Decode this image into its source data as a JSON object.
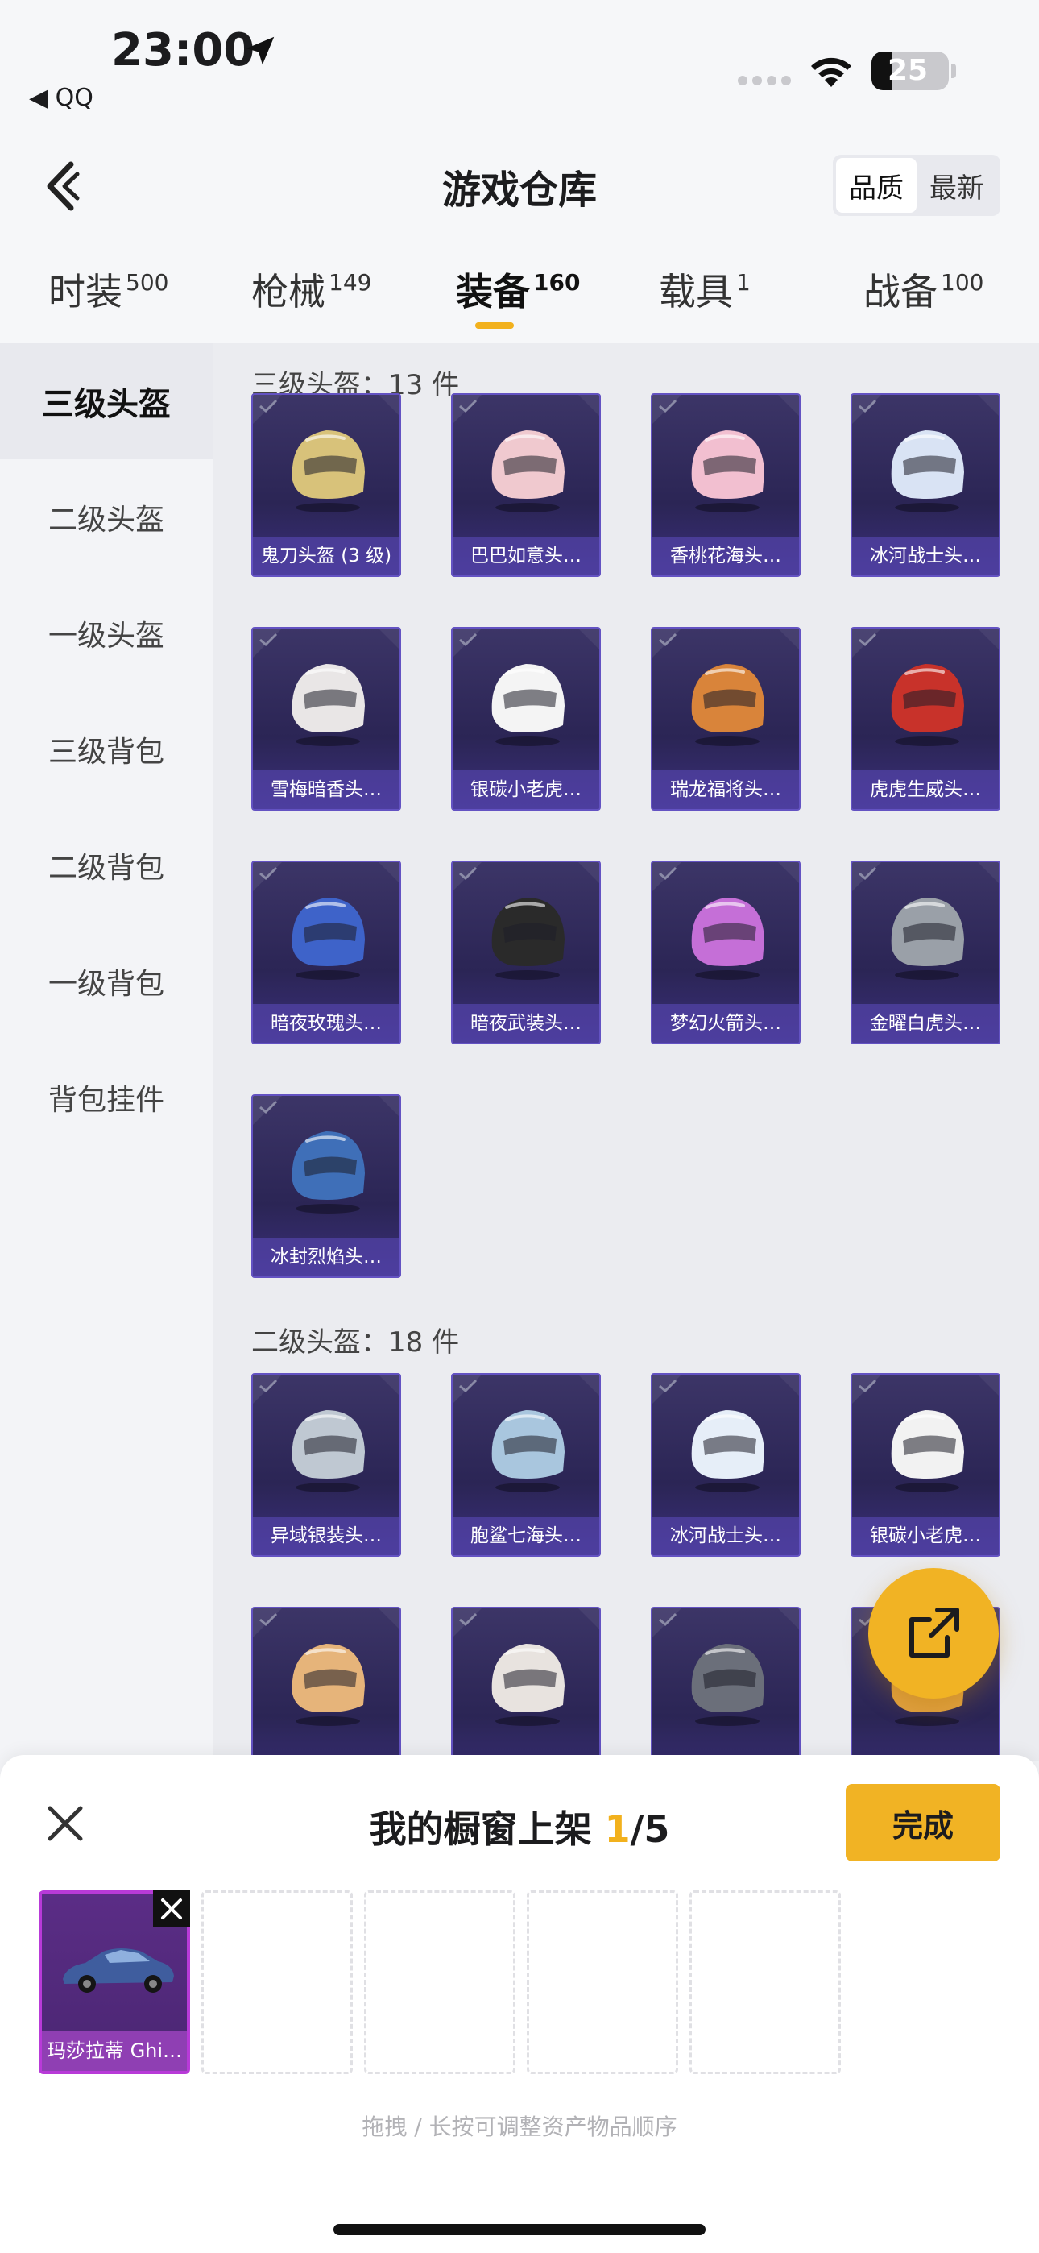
{
  "status_bar": {
    "time": "23:00",
    "back_app": "◀ QQ",
    "battery": "25"
  },
  "header": {
    "title": "游戏仓库",
    "sort_options": [
      "品质",
      "最新"
    ],
    "sort_active": "品质"
  },
  "tabs": [
    {
      "label": "时装",
      "count": "500"
    },
    {
      "label": "枪械",
      "count": "149"
    },
    {
      "label": "装备",
      "count": "160",
      "active": true
    },
    {
      "label": "载具",
      "count": "1"
    },
    {
      "label": "战备",
      "count": "100"
    }
  ],
  "sidebar": {
    "items": [
      "三级头盔",
      "二级头盔",
      "一级头盔",
      "三级背包",
      "二级背包",
      "一级背包",
      "背包挂件"
    ],
    "active": "三级头盔"
  },
  "sections": [
    {
      "title": "三级头盔：13 件",
      "items": [
        "鬼刀头盔 (3 级)",
        "巴巴如意头…",
        "香桃花海头…",
        "冰河战士头…",
        "雪梅暗香头…",
        "银碳小老虎…",
        "瑞龙福将头…",
        "虎虎生威头…",
        "暗夜玫瑰头…",
        "暗夜武装头…",
        "梦幻火箭头…",
        "金曜白虎头…",
        "冰封烈焰头…"
      ]
    },
    {
      "title": "二级头盔：18 件",
      "items": [
        "异域银装头…",
        "胞鲨七海头…",
        "冰河战士头…",
        "银碳小老虎…",
        "",
        "",
        "",
        ""
      ]
    }
  ],
  "helmet_colors": [
    "#d8c27a",
    "#f0c9cf",
    "#f2bfd0",
    "#d9e3f4",
    "#e9e6e6",
    "#f4f4f4",
    "#d9843a",
    "#c8322a",
    "#3e63c9",
    "#2a2a2a",
    "#c56fd7",
    "#9aa0a8",
    "#3f6fb8",
    "#bfc8d2",
    "#a9c6de",
    "#e6eef8",
    "#f2f2f2",
    "#e6b47a",
    "#e8e3df",
    "#6b6f7a",
    "#e0a040"
  ],
  "bottom_sheet": {
    "title_prefix": "我的橱窗上架 ",
    "current": "1",
    "total": "/5",
    "done_label": "完成",
    "slots": [
      {
        "label": "玛莎拉蒂 Ghi…"
      },
      {},
      {},
      {},
      {}
    ],
    "hint": "拖拽 / 长按可调整资产物品顺序"
  },
  "colors": {
    "accent": "#f1b324",
    "card_purple": "#2b2555",
    "slot_magenta": "#b83ad8"
  }
}
